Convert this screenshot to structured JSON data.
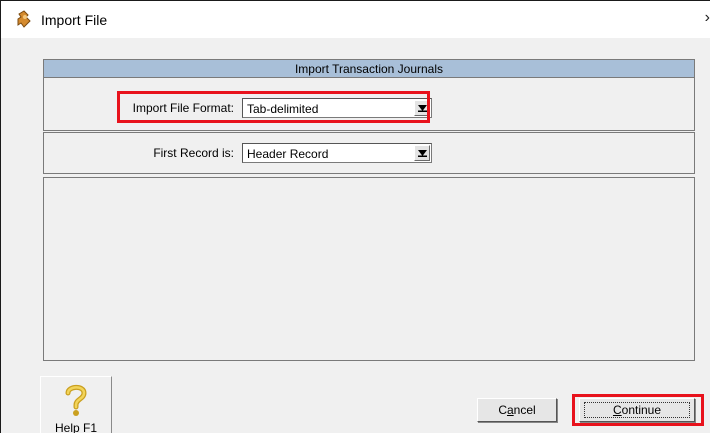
{
  "window": {
    "title": "Import File",
    "close_glyph": "›"
  },
  "panel": {
    "header": "Import Transaction Journals"
  },
  "fields": {
    "file_format": {
      "label": "Import File Format:",
      "value": "Tab-delimited"
    },
    "first_record": {
      "label": "First Record is:",
      "value": "Header Record"
    }
  },
  "buttons": {
    "help": "Help F1",
    "cancel_pre": "C",
    "cancel_key": "a",
    "cancel_post": "ncel",
    "continue_key": "C",
    "continue_post": "ontinue"
  },
  "colors": {
    "header_bg": "#a8bfd8",
    "highlight": "#e8121c",
    "dialog_bg": "#f0f0f0"
  },
  "icons": {
    "app": "import-file-icon",
    "help": "question-mark-icon"
  }
}
